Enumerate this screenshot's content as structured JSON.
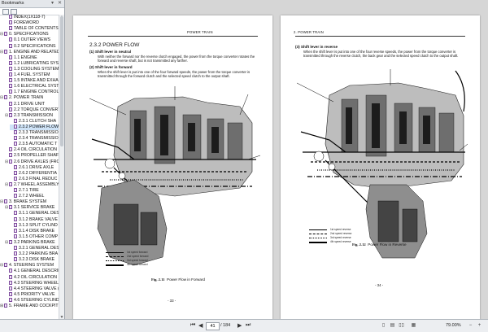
{
  "sidebar": {
    "title": "Bookmarks",
    "items": [
      {
        "label": "INDEX(1X118-7)",
        "level": 1,
        "twisty": ""
      },
      {
        "label": "FOREWORD",
        "level": 1,
        "twisty": ""
      },
      {
        "label": "TABLE OF CONTENTS",
        "level": 1,
        "twisty": ""
      },
      {
        "label": "0. SPECIFICATIONS",
        "level": 0,
        "twisty": "-"
      },
      {
        "label": "0.1 OUTER VIEWS",
        "level": 1,
        "twisty": ""
      },
      {
        "label": "0.2 SPECIFICATIONS",
        "level": 1,
        "twisty": ""
      },
      {
        "label": "1. ENGINE AND RELATED",
        "level": 0,
        "twisty": "-"
      },
      {
        "label": "1.1 ENGINE",
        "level": 1,
        "twisty": ""
      },
      {
        "label": "1.2 LUBRICATING SYST",
        "level": 1,
        "twisty": ""
      },
      {
        "label": "1.3 COOLING SYSTEM",
        "level": 1,
        "twisty": ""
      },
      {
        "label": "1.4 FUEL SYSTEM",
        "level": 1,
        "twisty": ""
      },
      {
        "label": "1.5 INTAKE AND EXHA",
        "level": 1,
        "twisty": ""
      },
      {
        "label": "1.6 ELECTRICAL SYSTE",
        "level": 1,
        "twisty": ""
      },
      {
        "label": "1.7 ENGINE CONTROL",
        "level": 1,
        "twisty": ""
      },
      {
        "label": "2. POWER TRAIN",
        "level": 0,
        "twisty": "-"
      },
      {
        "label": "2.1 DRIVE UNIT",
        "level": 1,
        "twisty": ""
      },
      {
        "label": "2.2 TORQUE CONVERTE",
        "level": 1,
        "twisty": ""
      },
      {
        "label": "2.3 TRANSMISSION",
        "level": 1,
        "twisty": "-"
      },
      {
        "label": "2.3.1 CLUTCH SHA",
        "level": 2,
        "twisty": ""
      },
      {
        "label": "2.3.2 POWER FLOW",
        "level": 2,
        "twisty": "",
        "selected": true
      },
      {
        "label": "2.3.3 TRANSMISSION",
        "level": 2,
        "twisty": ""
      },
      {
        "label": "2.3.4 TRANSMISSION",
        "level": 2,
        "twisty": ""
      },
      {
        "label": "2.3.5 AUTOMATIC T",
        "level": 2,
        "twisty": ""
      },
      {
        "label": "2.4 OIL CIRCULATION",
        "level": 1,
        "twisty": ""
      },
      {
        "label": "2.5 PROPELLER SHAFT",
        "level": 1,
        "twisty": ""
      },
      {
        "label": "2.6 DRIVE AXLES (FRO",
        "level": 1,
        "twisty": "-"
      },
      {
        "label": "2.6.1 DRIVE AXLE",
        "level": 2,
        "twisty": ""
      },
      {
        "label": "2.6.2 DIFFERENTIA",
        "level": 2,
        "twisty": ""
      },
      {
        "label": "2.6.3 FINAL REDUC",
        "level": 2,
        "twisty": ""
      },
      {
        "label": "2.7 WHEEL ASSEMBLY",
        "level": 1,
        "twisty": "-"
      },
      {
        "label": "2.7.1 TIRE",
        "level": 2,
        "twisty": ""
      },
      {
        "label": "2.7.2 WHEEL",
        "level": 2,
        "twisty": ""
      },
      {
        "label": "3. BRAKE SYSTEM",
        "level": 0,
        "twisty": "-"
      },
      {
        "label": "3.1 SERVICE BRAKE",
        "level": 1,
        "twisty": "-"
      },
      {
        "label": "3.1.1 GENERAL DES",
        "level": 2,
        "twisty": ""
      },
      {
        "label": "3.1.2 BRAKE VALVE",
        "level": 2,
        "twisty": ""
      },
      {
        "label": "3.1.3 SPLIT CYLIND",
        "level": 2,
        "twisty": ""
      },
      {
        "label": "3.1.4 DISK BRAKE",
        "level": 2,
        "twisty": ""
      },
      {
        "label": "3.1.5 OTHER COMP",
        "level": 2,
        "twisty": ""
      },
      {
        "label": "3.2 PARKING BRAKE",
        "level": 1,
        "twisty": "-"
      },
      {
        "label": "3.2.1 GENERAL DES",
        "level": 2,
        "twisty": ""
      },
      {
        "label": "3.2.2 PARKING BRA",
        "level": 2,
        "twisty": ""
      },
      {
        "label": "3.2.3 DISK BRAKE",
        "level": 2,
        "twisty": ""
      },
      {
        "label": "4. STEERING SYSTEM",
        "level": 0,
        "twisty": "-"
      },
      {
        "label": "4.1 GENERAL DESCRIP",
        "level": 1,
        "twisty": ""
      },
      {
        "label": "4.2 OIL CIRCULATION",
        "level": 1,
        "twisty": ""
      },
      {
        "label": "4.3 STEERING WHEEL",
        "level": 1,
        "twisty": ""
      },
      {
        "label": "4.4 STEERING VALVE (",
        "level": 1,
        "twisty": ""
      },
      {
        "label": "4.5 PRIORITY VALVE",
        "level": 1,
        "twisty": ""
      },
      {
        "label": "4.6 STEERING CYLIND",
        "level": 1,
        "twisty": ""
      },
      {
        "label": "5. FRAME AND COCKPIT",
        "level": 0,
        "twisty": "+"
      }
    ]
  },
  "left_page": {
    "header": "POWER TRAIN",
    "section_title": "2.3.2  POWER FLOW",
    "sub1": "(1)  Shift lever in neutral",
    "para1": "With neither the forward nor the reverse clutch engaged, the power from the torque converter rotates the forward and reverse shaft, but is not transmitted any farther.",
    "sub2": "(2)  Shift lever in forward",
    "para2": "When the shift lever is put into one of the four forward speeds, the power from the torque converter is transmitted through the forward clutch and the selected speed clutch to the output shaft.",
    "legend": [
      "1st speed forward",
      "2nd speed forward",
      "3rd speed forward",
      "4th speed forward"
    ],
    "figure_num": "Fig. 2.11",
    "figure_caption": "Power Flow in Forward",
    "page_number": "- 33 -"
  },
  "right_page": {
    "header": "2.  POWER TRAIN",
    "sub1": "(3)  Shift lever in reverse",
    "para1": "When the shift lever is put into one of the four reverse speeds, the power from the torque converter is transmitted through the reverse clutch, the back gear and the selected speed clutch to the output shaft.",
    "legend": [
      "1st speed reverse",
      "2nd speed reverse",
      "3rd speed reverse",
      "4th speed reverse"
    ],
    "figure_num": "Fig. 2.12",
    "figure_caption": "Power Flow in Reverse",
    "page_number": "- 34 -"
  },
  "toolbar": {
    "current_page": "41",
    "total_pages": "/ 184",
    "zoom": "79.00%"
  }
}
